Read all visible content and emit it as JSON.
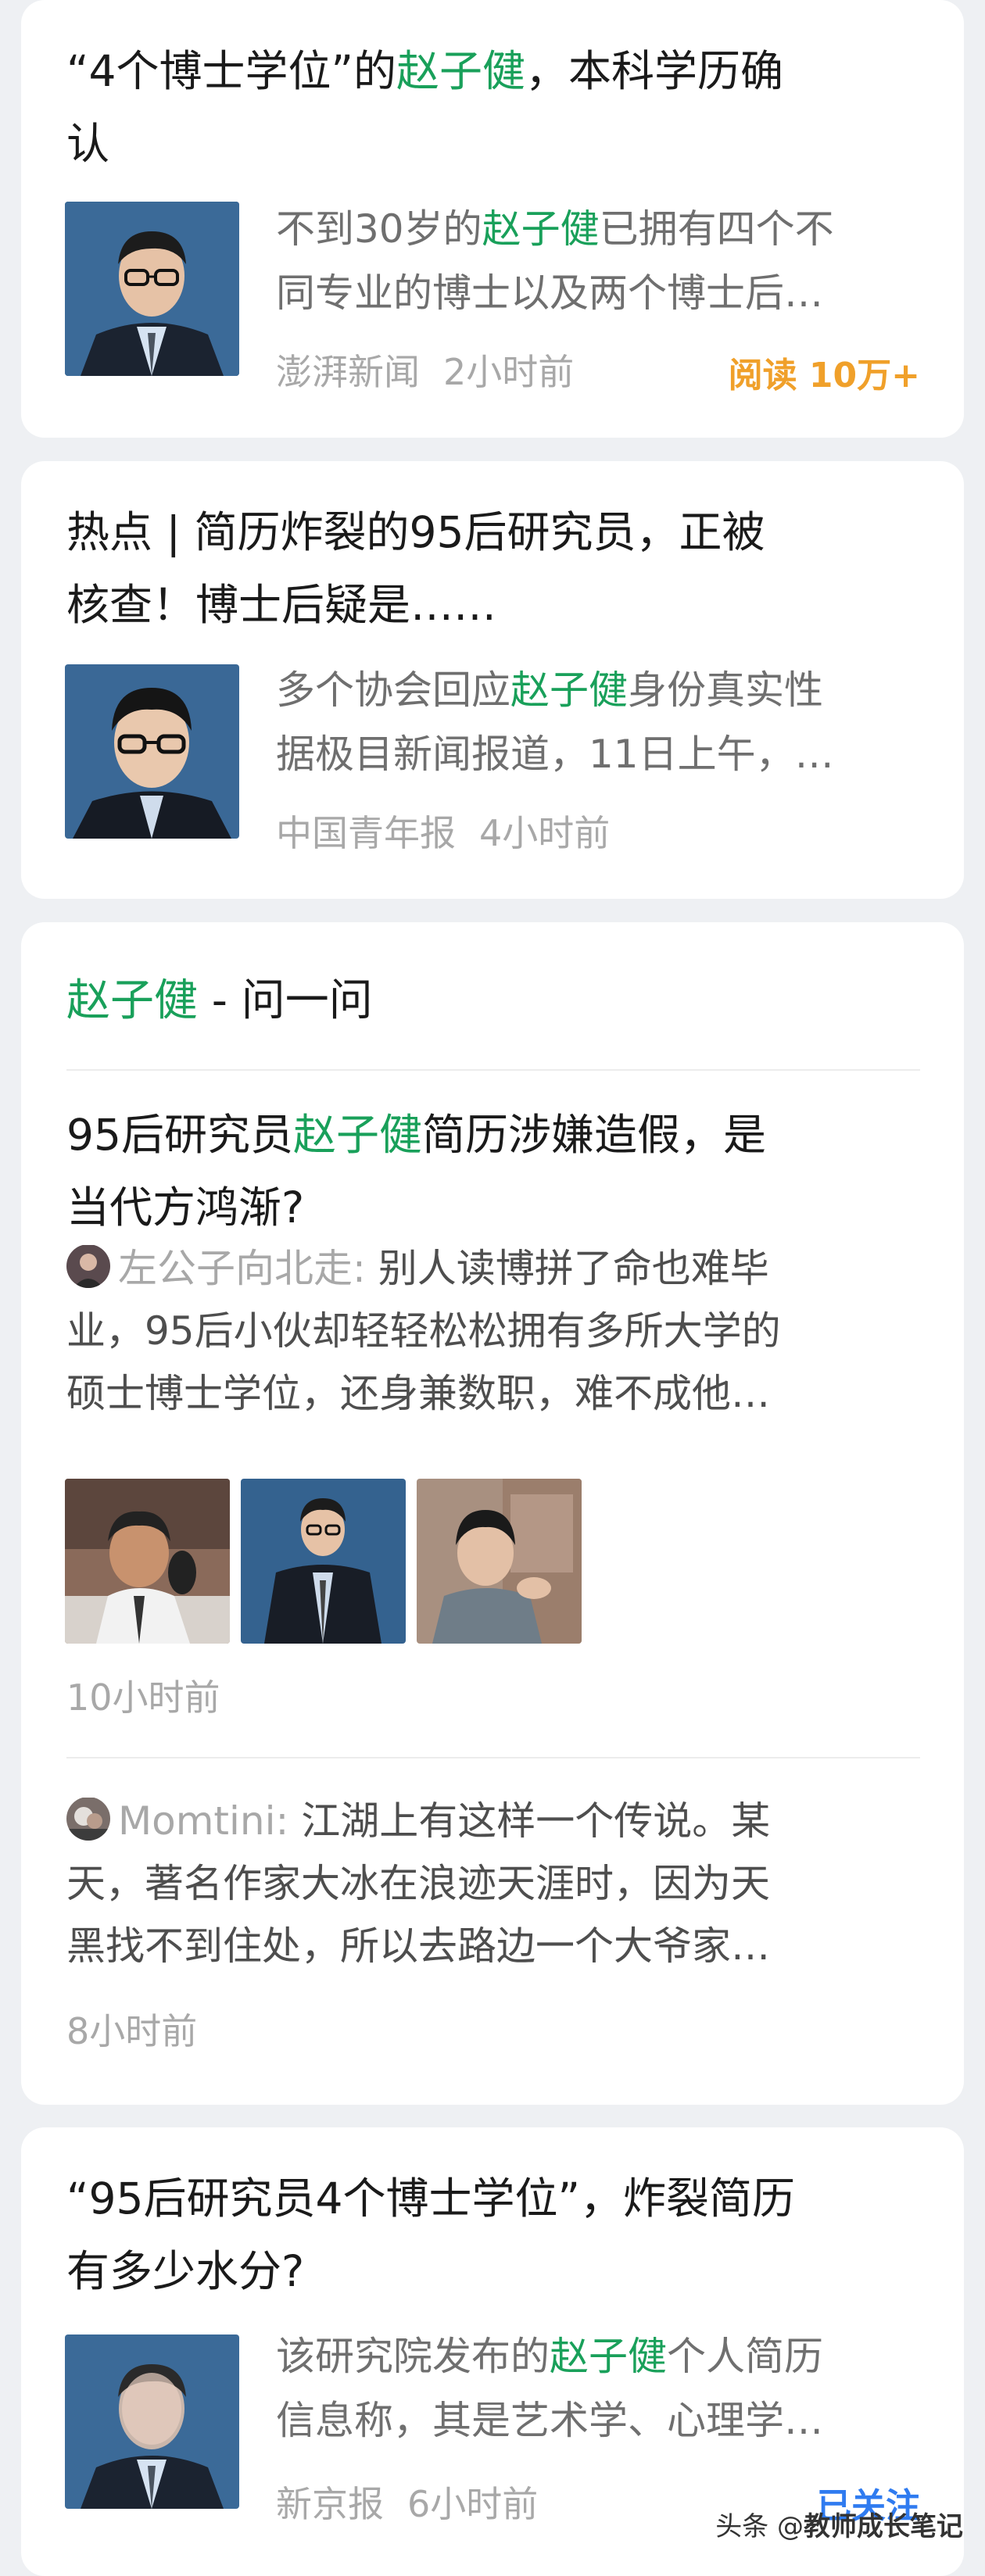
{
  "news1": {
    "title_pre": "“4个博士学位”的",
    "title_hl": "赵子健",
    "title_post_line1": "，本科学历确",
    "title_line2": "认",
    "snippet_line1_pre": "不到30岁的",
    "snippet_line1_hl": "赵子健",
    "snippet_line1_post": "已拥有四个不",
    "snippet_line2": "同专业的博士以及两个博士后…",
    "source": "澎湃新闻",
    "time": "2小时前",
    "reads": "阅读 10万+"
  },
  "news2": {
    "title_line1": "热点 | 简历炸裂的95后研究员，正被",
    "title_line2": "核查！博士后疑是……",
    "snippet_line1_pre": "多个协会回应",
    "snippet_line1_hl": "赵子健",
    "snippet_line1_post": "身份真实性",
    "snippet_line2": "据极目新闻报道，11日上午，…",
    "source": "中国青年报",
    "time": "4小时前"
  },
  "ask": {
    "header_hl": "赵子健",
    "header_rest": " - 问一问",
    "question_pre": "95后研究员",
    "question_hl": "赵子健",
    "question_post": "简历涉嫌造假，是",
    "question_line2": "当代方鸿渐?",
    "answer1": {
      "user": "左公子向北走:",
      "line1_text": " 别人读博拼了命也难毕",
      "line2": "业，95后小伙却轻轻松松拥有多所大学的",
      "line3": "硕士博士学位，还身兼数职，难不成他…",
      "time": "10小时前"
    },
    "answer2": {
      "user": "Momtini:",
      "line1_text": " 江湖上有这样一个传说。某",
      "line2": "天，著名作家大冰在浪迹天涯时，因为天",
      "line3": "黑找不到住处，所以去路边一个大爷家…",
      "time": "8小时前"
    }
  },
  "news3": {
    "title_line1": "“95后研究员4个博士学位”，炸裂简历",
    "title_line2": "有多少水分?",
    "snippet_line1_pre": "该研究院发布的",
    "snippet_line1_hl": "赵子健",
    "snippet_line1_post": "个人简历",
    "snippet_line2": "信息称，其是艺术学、心理学…",
    "source": "新京报",
    "time": "6小时前",
    "follow": "已关注"
  },
  "watermark": {
    "prefix": "头条 @",
    "name": "教师成长笔记"
  },
  "colors": {
    "highlight": "#19a05a",
    "reads": "#f0a02a",
    "follow": "#2f7bf0",
    "background": "#eef0f3"
  },
  "icons": {
    "portrait": "portrait-photo",
    "avatar": "user-avatar"
  }
}
